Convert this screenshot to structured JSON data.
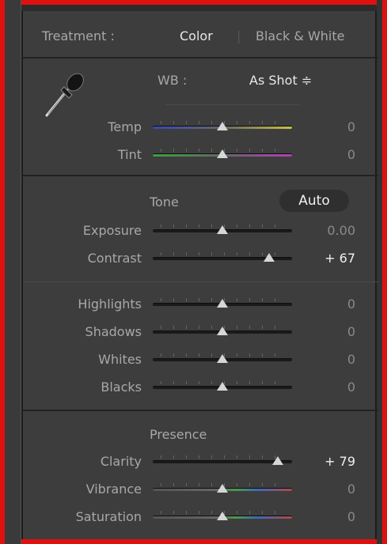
{
  "treatment": {
    "label": "Treatment :",
    "option_color": "Color",
    "separator": "|",
    "option_bw": "Black & White"
  },
  "wb": {
    "label": "WB :",
    "value": "As Shot ≑",
    "eyedropper_icon": "eyedropper-icon"
  },
  "wb_sliders": [
    {
      "label": "Temp",
      "value": "0",
      "level": 0.5,
      "colors": [
        "#3a46b8",
        "#c8c040"
      ]
    },
    {
      "label": "Tint",
      "value": "0",
      "level": 0.5,
      "colors": [
        "#3aa040",
        "#b040b8"
      ]
    }
  ],
  "tone": {
    "title": "Tone",
    "auto_label": "Auto",
    "sliders": [
      {
        "label": "Exposure",
        "value": "0.00",
        "level": 0.5
      },
      {
        "label": "Contrast",
        "value": "+ 67",
        "level": 0.835
      }
    ],
    "sliders2": [
      {
        "label": "Highlights",
        "value": "0",
        "level": 0.5
      },
      {
        "label": "Shadows",
        "value": "0",
        "level": 0.5
      },
      {
        "label": "Whites",
        "value": "0",
        "level": 0.5
      },
      {
        "label": "Blacks",
        "value": "0",
        "level": 0.5
      }
    ]
  },
  "presence": {
    "title": "Presence",
    "sliders": [
      {
        "label": "Clarity",
        "value": "+ 79",
        "level": 0.895
      },
      {
        "label": "Vibrance",
        "value": "0",
        "level": 0.5
      },
      {
        "label": "Saturation",
        "value": "0",
        "level": 0.5
      }
    ]
  },
  "colors": {
    "frame": "#e01010",
    "panel": "#3d3d3d"
  }
}
